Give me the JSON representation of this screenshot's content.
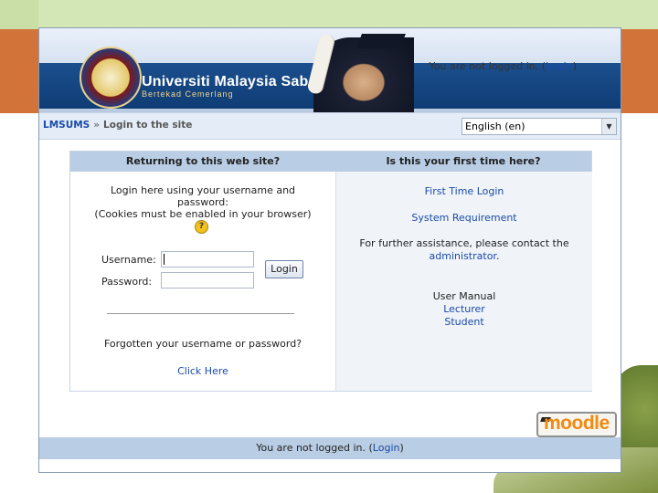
{
  "header": {
    "university_name": "Universiti Malaysia Sabah",
    "motto": "Bertekad Cemerlang",
    "login_status_prefix": "You are not logged in. (",
    "login_link": "Login",
    "login_status_suffix": ")"
  },
  "navbar": {
    "breadcrumb_home": "LMSUMS",
    "breadcrumb_sep": "»",
    "breadcrumb_current": "Login to the site",
    "language_selected": "English (en)"
  },
  "login_box": {
    "left_header": "Returning to this web site?",
    "right_header": "Is this your first time here?",
    "intro_line1": "Login here using your username and",
    "intro_line2": "password:",
    "intro_line3": "(Cookies must be enabled in your browser)",
    "help_icon": "?",
    "username_label": "Username:",
    "password_label": "Password:",
    "login_button": "Login",
    "forgot_text": "Forgotten your username or password?",
    "click_here": "Click Here"
  },
  "first_time": {
    "first_time_login": "First Time Login",
    "system_requirement": "System Requirement",
    "assistance_line": "For further assistance, please contact the",
    "administrator": "administrator",
    "administrator_suffix": ".",
    "user_manual": "User Manual",
    "lecturer": "Lecturer",
    "student": "Student"
  },
  "footer": {
    "moodle_logo": "moodle",
    "status_prefix": "You are not logged in. (",
    "login_link": "Login",
    "status_suffix": ")"
  }
}
